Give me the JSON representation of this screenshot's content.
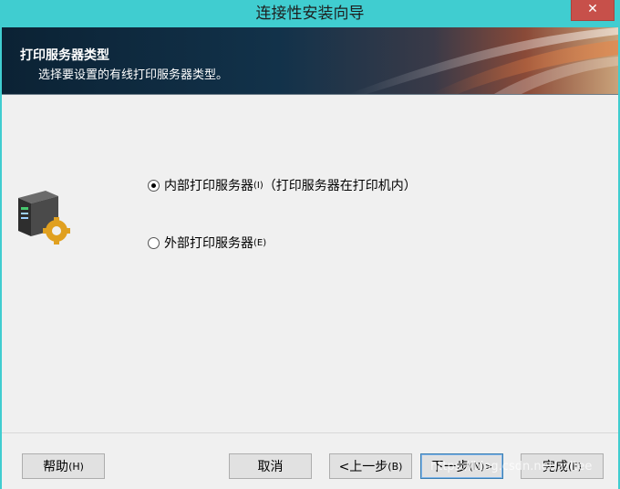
{
  "window": {
    "title": "连接性安装向导",
    "close_glyph": "✕"
  },
  "header": {
    "title": "打印服务器类型",
    "subtitle": "选择要设置的有线打印服务器类型。"
  },
  "options": [
    {
      "label": "内部打印服务器",
      "accel": "(I)",
      "note": "（打印服务器在打印机内）",
      "selected": true
    },
    {
      "label": "外部打印服务器",
      "accel": "(E)",
      "note": "",
      "selected": false
    }
  ],
  "buttons": {
    "help": {
      "label": "帮助",
      "accel": "(H)"
    },
    "cancel": {
      "label": "取消"
    },
    "back": {
      "label": "<上一步",
      "accel": "(B)"
    },
    "next": {
      "label": "下一步",
      "accel": "(N)>"
    },
    "finish": {
      "label": "完成",
      "accel": "(F)"
    }
  },
  "watermark": "https://blog.csdn.net/zzltee",
  "colors": {
    "titlebar": "#40cdd0",
    "header_bg": "#0d2638",
    "close_button": "#c7504a"
  },
  "icons": {
    "header_art": "abstract-swoosh",
    "wizard": "printer-gear-icon"
  }
}
